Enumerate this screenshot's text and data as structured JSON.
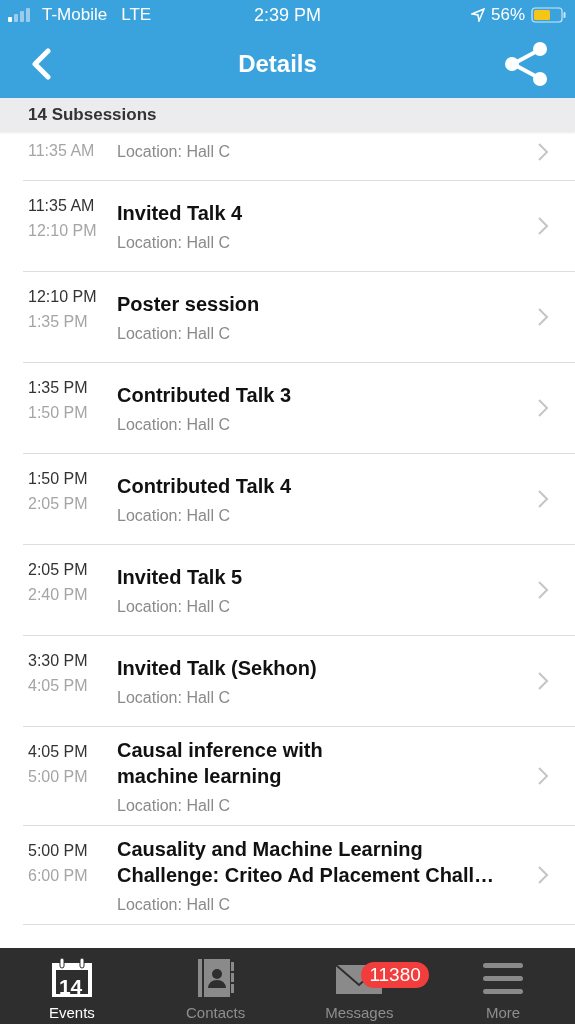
{
  "status_bar": {
    "carrier": "T-Mobile",
    "network": "LTE",
    "time": "2:39 PM",
    "battery": "56%"
  },
  "nav": {
    "title": "Details"
  },
  "section": {
    "title": "14 Subsessions"
  },
  "sessions": [
    {
      "end": "11:35 AM",
      "location": "Location: Hall C"
    },
    {
      "start": "11:35 AM",
      "end": "12:10 PM",
      "title": "Invited Talk 4",
      "location": "Location: Hall C"
    },
    {
      "start": "12:10 PM",
      "end": "1:35 PM",
      "title": "Poster session",
      "location": "Location: Hall C"
    },
    {
      "start": "1:35 PM",
      "end": "1:50 PM",
      "title": "Contributed Talk 3",
      "location": "Location: Hall C"
    },
    {
      "start": "1:50 PM",
      "end": "2:05 PM",
      "title": "Contributed Talk 4",
      "location": "Location: Hall C"
    },
    {
      "start": "2:05 PM",
      "end": "2:40 PM",
      "title": "Invited Talk 5",
      "location": "Location: Hall C"
    },
    {
      "start": "3:30 PM",
      "end": "4:05 PM",
      "title": "Invited Talk (Sekhon)",
      "location": "Location: Hall C"
    },
    {
      "start": "4:05 PM",
      "end": "5:00 PM",
      "title_lines": [
        "Causal inference with",
        "machine learning"
      ],
      "location": "Location: Hall C"
    },
    {
      "start": "5:00 PM",
      "end": "6:00 PM",
      "title_lines": [
        "Causality and Machine Learning",
        "Challenge: Criteo Ad Placement Chall…"
      ],
      "location": "Location: Hall C"
    }
  ],
  "tabs": [
    {
      "kind": "calendar",
      "label": "Events",
      "icon_text": "14",
      "selected": true
    },
    {
      "kind": "contacts",
      "label": "Contacts",
      "selected": false
    },
    {
      "kind": "messages",
      "label": "Messages",
      "badge": "11380",
      "selected": false
    },
    {
      "kind": "menu",
      "label": "More",
      "selected": false
    }
  ]
}
